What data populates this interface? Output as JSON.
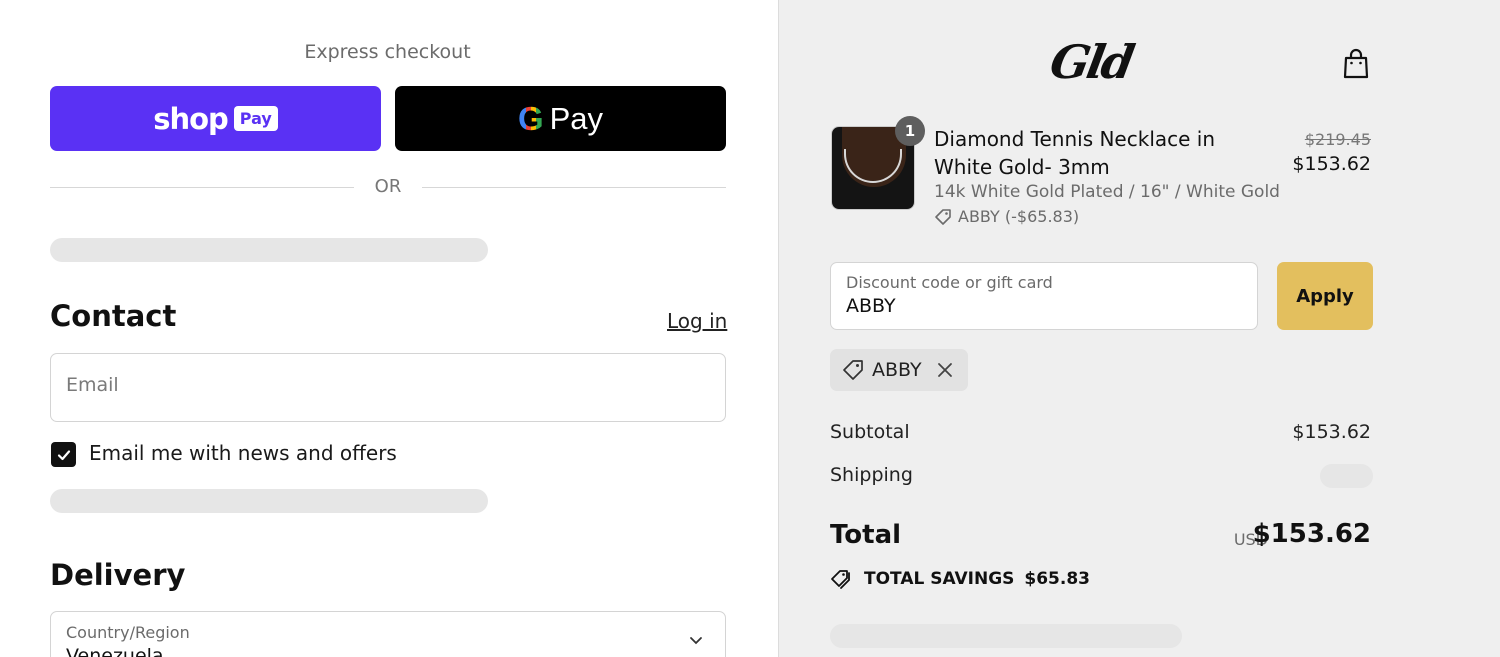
{
  "express": {
    "title": "Express checkout",
    "shop_pay_label": "shop",
    "shop_pay_badge": "Pay",
    "gpay_g": "G",
    "gpay_label": "Pay",
    "or_label": "OR"
  },
  "contact": {
    "heading": "Contact",
    "login_link": "Log in",
    "email_placeholder": "Email",
    "newsletter_label": "Email me with news and offers",
    "newsletter_checked": true
  },
  "delivery": {
    "heading": "Delivery",
    "country_label": "Country/Region",
    "country_value": "Venezuela"
  },
  "store": {
    "logo_text": "Gld"
  },
  "cart": {
    "item": {
      "quantity": "1",
      "name": "Diamond Tennis Necklace in White Gold- 3mm",
      "variant": "14k White Gold Plated / 16\" / White Gold",
      "discount": "ABBY (-$65.83)",
      "original_price": "$219.45",
      "price": "$153.62"
    }
  },
  "discount": {
    "label": "Discount code or gift card",
    "value": "ABBY",
    "apply_label": "Apply",
    "applied_code": "ABBY"
  },
  "summary": {
    "subtotal_label": "Subtotal",
    "subtotal_value": "$153.62",
    "shipping_label": "Shipping",
    "total_label": "Total",
    "currency": "USD",
    "total_value": "$153.62",
    "savings_label": "TOTAL SAVINGS",
    "savings_value": "$65.83"
  },
  "colors": {
    "shop_pay": "#5a31f4",
    "apply_button": "#e3bf5e",
    "summary_bg": "#efefef"
  }
}
